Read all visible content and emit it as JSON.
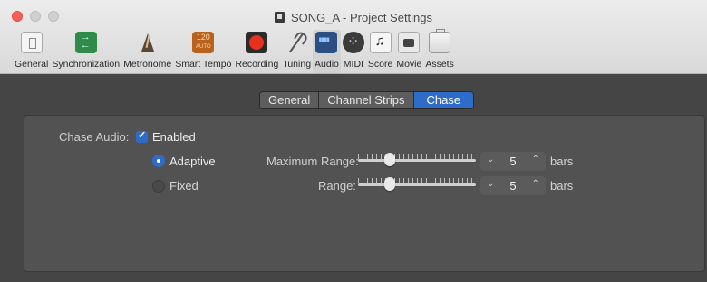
{
  "window": {
    "title": "SONG_A - Project Settings",
    "close_color": "#fc5f57"
  },
  "toolbar": {
    "items": [
      {
        "label": "General",
        "icon": "general-icon"
      },
      {
        "label": "Synchronization",
        "icon": "synchronization-icon"
      },
      {
        "label": "Metronome",
        "icon": "metronome-icon"
      },
      {
        "label": "Smart Tempo",
        "icon": "smart-tempo-icon",
        "icon_text": "120",
        "icon_subtext": "AUTO"
      },
      {
        "label": "Recording",
        "icon": "record-icon"
      },
      {
        "label": "Tuning",
        "icon": "tuning-fork-icon"
      },
      {
        "label": "Audio",
        "icon": "audio-waveform-icon",
        "selected": true
      },
      {
        "label": "MIDI",
        "icon": "midi-port-icon"
      },
      {
        "label": "Score",
        "icon": "score-note-icon"
      },
      {
        "label": "Movie",
        "icon": "movie-camera-icon"
      },
      {
        "label": "Assets",
        "icon": "briefcase-icon"
      }
    ]
  },
  "tabs": {
    "items": [
      {
        "label": "General"
      },
      {
        "label": "Channel Strips"
      },
      {
        "label": "Chase",
        "selected": true
      }
    ]
  },
  "chase": {
    "chase_audio_label": "Chase Audio:",
    "enabled_label": "Enabled",
    "enabled": true,
    "adaptive_label": "Adaptive",
    "fixed_label": "Fixed",
    "mode": "Adaptive",
    "maximum_range_label": "Maximum Range:",
    "range_label": "Range:",
    "maximum_range_value": "5",
    "range_value": "5",
    "maximum_range_slider_fraction": 0.27,
    "range_slider_fraction": 0.27,
    "unit_label": "bars"
  },
  "colors": {
    "accent": "#2f6cc9",
    "content_bg": "#454545",
    "panel_bg": "#525252"
  }
}
